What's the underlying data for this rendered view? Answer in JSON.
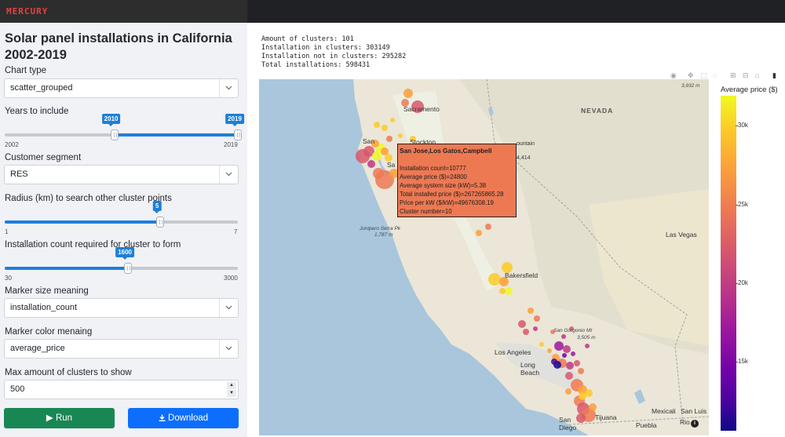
{
  "header": {
    "brand": "MERCURY"
  },
  "sidebar": {
    "title": "Solar panel installations in California 2002-2019",
    "chart_type": {
      "label": "Chart type",
      "value": "scatter_grouped"
    },
    "years": {
      "label": "Years to include",
      "min": "2002",
      "max": "2019",
      "low": "2010",
      "high": "2019",
      "low_frac": 0.47,
      "high_frac": 1.0
    },
    "segment": {
      "label": "Customer segment",
      "value": "RES"
    },
    "radius": {
      "label": "Radius (km) to search other cluster points",
      "min": "1",
      "max": "7",
      "value": "5",
      "frac": 0.667
    },
    "inst_count": {
      "label": "Installation count required for cluster to form",
      "min": "30",
      "max": "3000",
      "value": "1600",
      "frac": 0.529
    },
    "marker_size": {
      "label": "Marker size meaning",
      "value": "installation_count"
    },
    "marker_color": {
      "label": "Marker color menaing",
      "value": "average_price"
    },
    "max_clusters": {
      "label": "Max amount of clusters to show",
      "value": "500"
    },
    "run_label": "Run",
    "download_label": "Download"
  },
  "stats": {
    "line1": "Amount of clusters: 101",
    "line2": "Installation in clusters: 303149",
    "line3": "Installation not in clusters: 295282",
    "line4": "Total installations: 598431"
  },
  "tooltip": {
    "title": "San Jose,Los Gatos,Campbell",
    "line1": "Installation count=10777",
    "line2": "Average price ($)=24800",
    "line3": "Average system size (kW)=5.38",
    "line4": "Total installed price ($)=267265865.28",
    "line5": "Price per kW ($/kW)=49676308.19",
    "line6": "Cluster number=10"
  },
  "map_labels": {
    "sacramento": "Sacramento",
    "nevada": "NEVADA",
    "stockton": "Stockton",
    "fountain": "ountain",
    "elev": "4,414",
    "san": "San",
    "sa": "Sa",
    "las_vegas": "Las Vegas",
    "bakersfield": "Bakersfield",
    "los_angeles": "Los Angeles",
    "long_beach": "Long Beach",
    "san_diego": "San Diego",
    "mexicali": "Mexicali",
    "san_luis": "San Luis",
    "puebla": "Puebla",
    "rio": "Rio",
    "tijuana": "Tijuana",
    "junipero": "Junipero Serra Pk",
    "junipero_elev": "1,787 m",
    "gorgonio": "San Gorgonio Mt",
    "gorgonio_elev": "3,505 m",
    "corner_elev": "3,932 m",
    "colorbar_title": "Average price ($)"
  },
  "colorbar": {
    "ticks": [
      {
        "label": "30k",
        "frac": 0.09
      },
      {
        "label": "25k",
        "frac": 0.325
      },
      {
        "label": "20k",
        "frac": 0.56
      },
      {
        "label": "15k",
        "frac": 0.795
      }
    ]
  },
  "colors": {
    "run_button": "#198754",
    "download_button": "#0d6efd",
    "slider_accent": "#1e7fd9",
    "brand": "#e8413d"
  }
}
